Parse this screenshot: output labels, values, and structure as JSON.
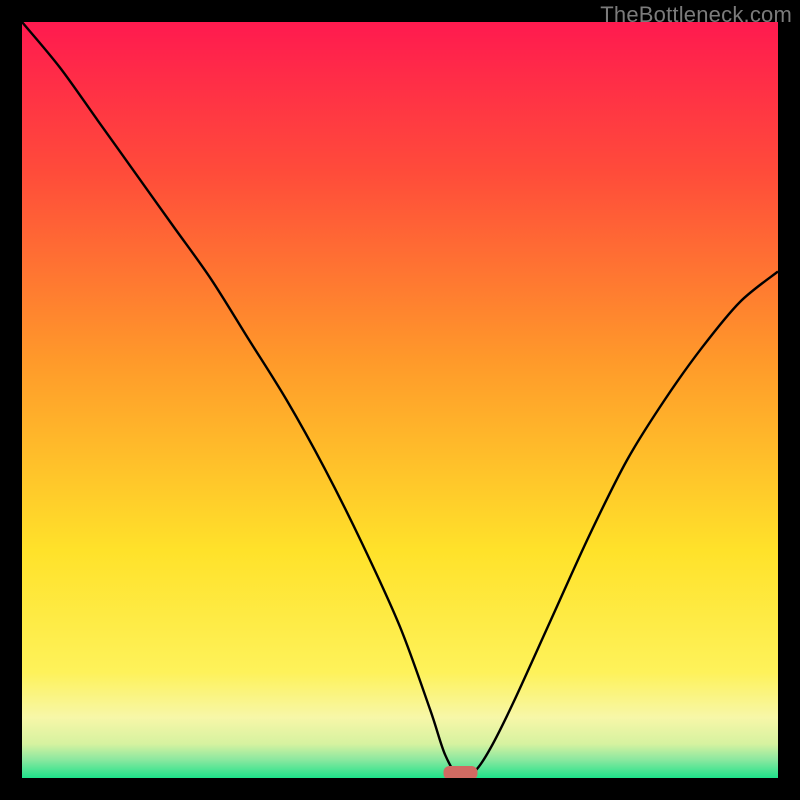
{
  "watermark": "TheBottleneck.com",
  "colors": {
    "frame": "#000000",
    "watermark": "#7b7b7b",
    "curve": "#000000",
    "marker_fill": "#d06a62",
    "gradient_stops": [
      {
        "offset": 0.0,
        "color": "#ff1a4f"
      },
      {
        "offset": 0.2,
        "color": "#ff4c3a"
      },
      {
        "offset": 0.45,
        "color": "#ff9a2a"
      },
      {
        "offset": 0.7,
        "color": "#ffe22a"
      },
      {
        "offset": 0.86,
        "color": "#fef25a"
      },
      {
        "offset": 0.92,
        "color": "#f7f7a8"
      },
      {
        "offset": 0.955,
        "color": "#d6f2a0"
      },
      {
        "offset": 0.975,
        "color": "#8ee8a0"
      },
      {
        "offset": 1.0,
        "color": "#1ee28a"
      }
    ]
  },
  "chart_data": {
    "type": "line",
    "title": "",
    "xlabel": "",
    "ylabel": "",
    "marker": {
      "x": 0.58,
      "y": 0.0
    },
    "x": [
      0.0,
      0.05,
      0.1,
      0.15,
      0.2,
      0.25,
      0.3,
      0.35,
      0.4,
      0.45,
      0.5,
      0.54,
      0.56,
      0.58,
      0.6,
      0.62,
      0.65,
      0.7,
      0.75,
      0.8,
      0.85,
      0.9,
      0.95,
      1.0
    ],
    "y": [
      1.0,
      0.94,
      0.87,
      0.8,
      0.73,
      0.66,
      0.58,
      0.5,
      0.41,
      0.31,
      0.2,
      0.09,
      0.03,
      0.0,
      0.01,
      0.04,
      0.1,
      0.21,
      0.32,
      0.42,
      0.5,
      0.57,
      0.63,
      0.67
    ],
    "ylim": [
      0,
      1
    ],
    "xlim": [
      0,
      1
    ]
  }
}
